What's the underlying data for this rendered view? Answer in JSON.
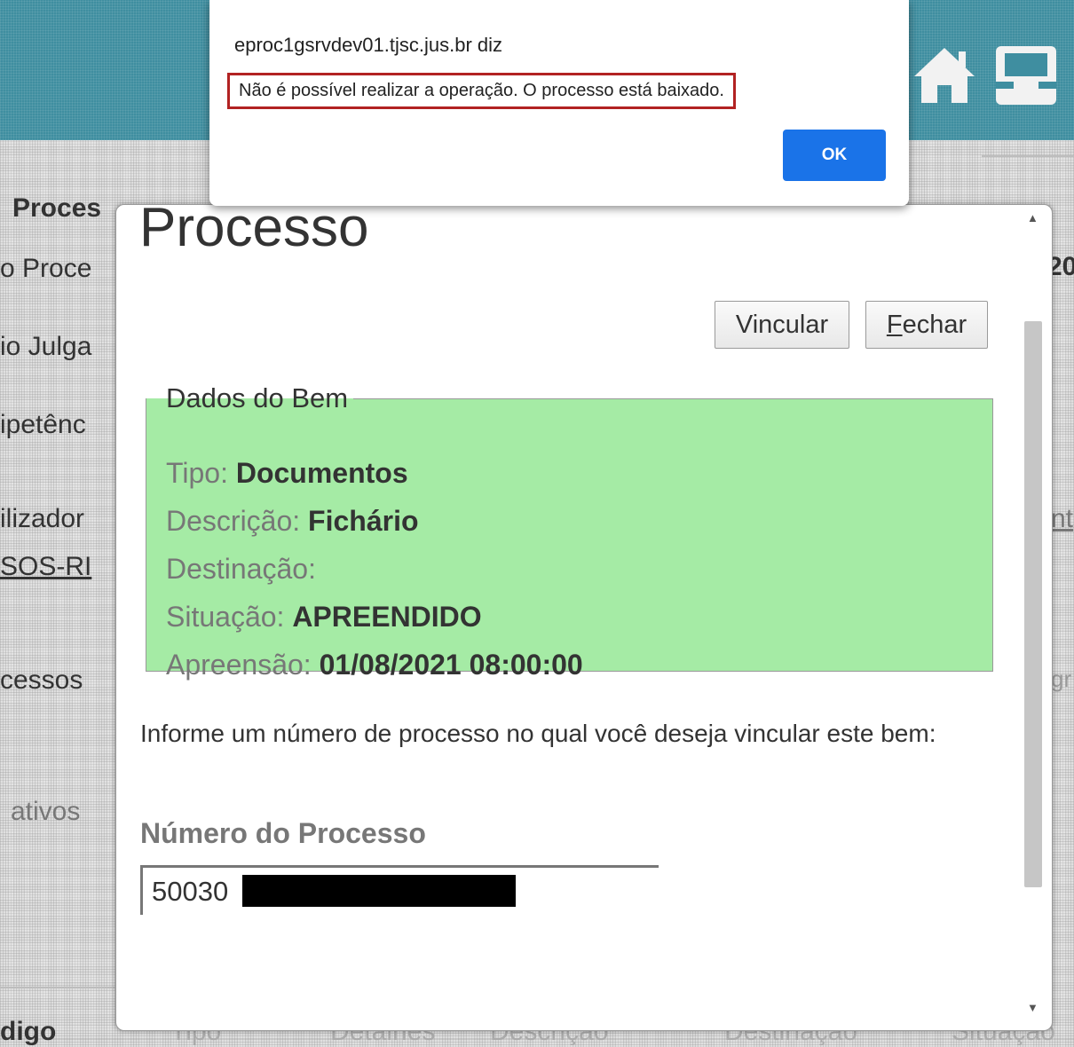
{
  "background": {
    "left_labels": [
      "Proces",
      "o Proce",
      "io Julga",
      "ipetênc",
      "ilizador",
      "SOS-RI",
      "cessos",
      "ativos",
      "digo"
    ],
    "right_labels": [
      "20",
      "nt",
      "gr"
    ],
    "bottom_headers": [
      "Tipo",
      "Detalhes",
      "Descrição",
      "Destinação",
      "Situação"
    ]
  },
  "modal": {
    "title": "Processo",
    "buttons": {
      "vincular": "Vincular",
      "fechar": "Fechar"
    },
    "dados": {
      "legend": "Dados do Bem",
      "tipo_label": "Tipo:",
      "tipo_value": "Documentos",
      "descricao_label": "Descrição:",
      "descricao_value": "Fichário",
      "destinacao_label": "Destinação:",
      "destinacao_value": "",
      "situacao_label": "Situação:",
      "situacao_value": "APREENDIDO",
      "apreensao_label": "Apreensão:",
      "apreensao_value": "01/08/2021 08:00:00"
    },
    "info_text": "Informe um número de processo no qual você deseja vincular este bem:",
    "numero_label": "Número do Processo",
    "numero_value": "50030"
  },
  "alert": {
    "origin": "eproc1gsrvdev01.tjsc.jus.br diz",
    "message": "Não é possível realizar a operação. O processo está baixado.",
    "ok_label": "OK"
  },
  "colors": {
    "header_teal": "#3f8ea0",
    "dados_green": "#a5eba5",
    "ok_blue": "#1a73e8",
    "highlight_red": "#b22222"
  },
  "icons": [
    "home-icon",
    "inbox-icon"
  ]
}
